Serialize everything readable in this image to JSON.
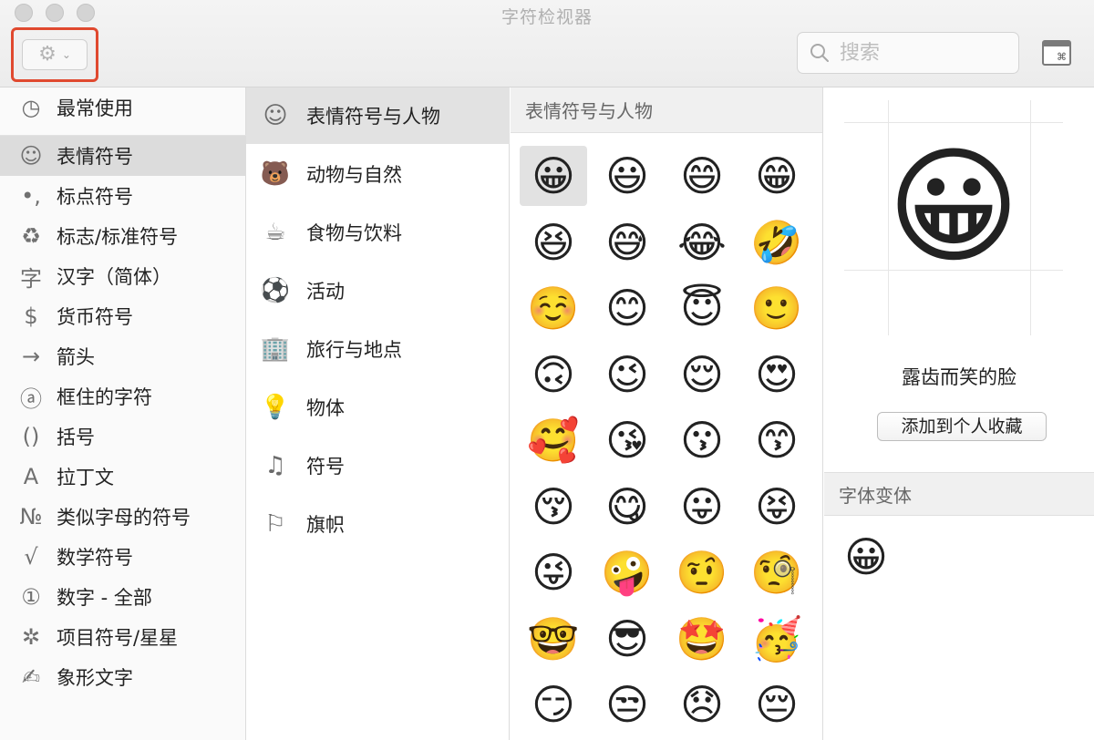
{
  "window": {
    "title": "字符检视器"
  },
  "toolbar": {
    "gear_icon": "⚙",
    "chevron_icon": "⌄",
    "search_placeholder": "搜索",
    "viewer_glyph": "⌘"
  },
  "sidebar": {
    "items": [
      {
        "icon": "◷",
        "label": "最常使用"
      },
      {
        "icon": "☺",
        "label": "表情符号"
      },
      {
        "icon": "•,",
        "label": "标点符号"
      },
      {
        "icon": "♻",
        "label": "标志/标准符号"
      },
      {
        "icon": "字",
        "label": "汉字（简体）"
      },
      {
        "icon": "$",
        "label": "货币符号"
      },
      {
        "icon": "→",
        "label": "箭头"
      },
      {
        "icon": "ⓐ",
        "label": "框住的字符"
      },
      {
        "icon": "()",
        "label": "括号"
      },
      {
        "icon": "A",
        "label": "拉丁文"
      },
      {
        "icon": "№",
        "label": "类似字母的符号"
      },
      {
        "icon": "√",
        "label": "数学符号"
      },
      {
        "icon": "①",
        "label": "数字 - 全部"
      },
      {
        "icon": "✲",
        "label": "项目符号/星星"
      },
      {
        "icon": "✍",
        "label": "象形文字"
      }
    ],
    "selected": "表情符号"
  },
  "categories": {
    "items": [
      {
        "icon": "☺",
        "label": "表情符号与人物"
      },
      {
        "icon": "🐻",
        "label": "动物与自然"
      },
      {
        "icon": "☕",
        "label": "食物与饮料"
      },
      {
        "icon": "⚽",
        "label": "活动"
      },
      {
        "icon": "🏢",
        "label": "旅行与地点"
      },
      {
        "icon": "💡",
        "label": "物体"
      },
      {
        "icon": "♫",
        "label": "符号"
      },
      {
        "icon": "⚐",
        "label": "旗帜"
      }
    ],
    "selected": "表情符号与人物"
  },
  "grid": {
    "header": "表情符号与人物",
    "emojis": [
      "😀",
      "😃",
      "😄",
      "😁",
      "😆",
      "😅",
      "😂",
      "🤣",
      "☺️",
      "😊",
      "😇",
      "🙂",
      "🙃",
      "😉",
      "😌",
      "😍",
      "🥰",
      "😘",
      "😗",
      "😙",
      "😚",
      "😋",
      "😛",
      "😝",
      "😜",
      "🤪",
      "🤨",
      "🧐",
      "🤓",
      "😎",
      "🤩",
      "🥳",
      "😏",
      "😒",
      "😞",
      "😔"
    ],
    "selected_index": 0
  },
  "detail": {
    "preview_emoji": "😀",
    "character_name": "露齿而笑的脸",
    "favorite_button": "添加到个人收藏",
    "variants_header": "字体变体",
    "variants": [
      "😀"
    ]
  }
}
